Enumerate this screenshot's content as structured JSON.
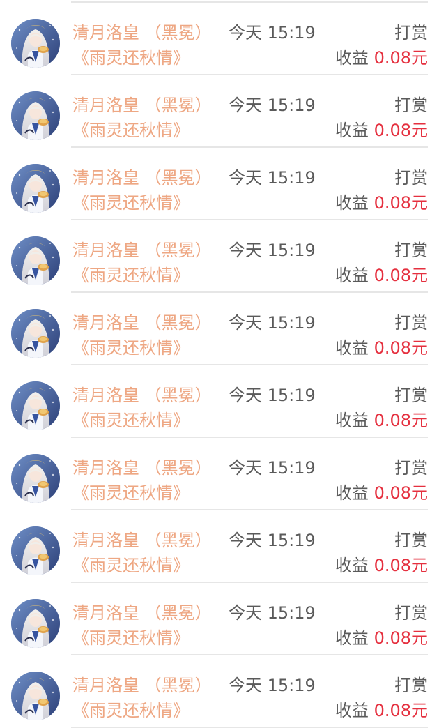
{
  "records": [
    {
      "name": "清月洛皇 （黑冕）",
      "time": "今天 15:19",
      "type": "打赏",
      "book": "《雨灵还秋情》",
      "income_label": "收益",
      "amount": "0.08元"
    },
    {
      "name": "清月洛皇 （黑冕）",
      "time": "今天 15:19",
      "type": "打赏",
      "book": "《雨灵还秋情》",
      "income_label": "收益",
      "amount": "0.08元"
    },
    {
      "name": "清月洛皇 （黑冕）",
      "time": "今天 15:19",
      "type": "打赏",
      "book": "《雨灵还秋情》",
      "income_label": "收益",
      "amount": "0.08元"
    },
    {
      "name": "清月洛皇 （黑冕）",
      "time": "今天 15:19",
      "type": "打赏",
      "book": "《雨灵还秋情》",
      "income_label": "收益",
      "amount": "0.08元"
    },
    {
      "name": "清月洛皇 （黑冕）",
      "time": "今天 15:19",
      "type": "打赏",
      "book": "《雨灵还秋情》",
      "income_label": "收益",
      "amount": "0.08元"
    },
    {
      "name": "清月洛皇 （黑冕）",
      "time": "今天 15:19",
      "type": "打赏",
      "book": "《雨灵还秋情》",
      "income_label": "收益",
      "amount": "0.08元"
    },
    {
      "name": "清月洛皇 （黑冕）",
      "time": "今天 15:19",
      "type": "打赏",
      "book": "《雨灵还秋情》",
      "income_label": "收益",
      "amount": "0.08元"
    },
    {
      "name": "清月洛皇 （黑冕）",
      "time": "今天 15:19",
      "type": "打赏",
      "book": "《雨灵还秋情》",
      "income_label": "收益",
      "amount": "0.08元"
    },
    {
      "name": "清月洛皇 （黑冕）",
      "time": "今天 15:19",
      "type": "打赏",
      "book": "《雨灵还秋情》",
      "income_label": "收益",
      "amount": "0.08元"
    },
    {
      "name": "清月洛皇 （黑冕）",
      "time": "今天 15:19",
      "type": "打赏",
      "book": "《雨灵还秋情》",
      "income_label": "收益",
      "amount": "0.08元"
    }
  ],
  "colors": {
    "name_text": "#eea783",
    "book_text": "#eea783",
    "secondary_text": "#5a5a5a",
    "amount_text": "#e5303f",
    "divider": "#e6e6e6"
  },
  "icons": {
    "avatar": "anime-character-avatar"
  }
}
